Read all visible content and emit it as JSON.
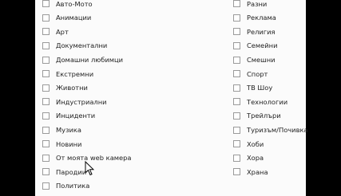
{
  "categories": {
    "left": [
      "Авто-Мото",
      "Анимации",
      "Арт",
      "Документални",
      "Домашни любимци",
      "Екстремни",
      "Животни",
      "Индустриални",
      "Инциденти",
      "Музика",
      "Новини",
      "От моята web камера",
      "Пародии",
      "Политика"
    ],
    "right": [
      "Разни",
      "Реклама",
      "Религия",
      "Семейни",
      "Смешни",
      "Спорт",
      "ТВ Шоу",
      "Технологии",
      "Трейлъри",
      "Туризъм/Почивка",
      "Хоби",
      "Хора",
      "Храна"
    ]
  }
}
